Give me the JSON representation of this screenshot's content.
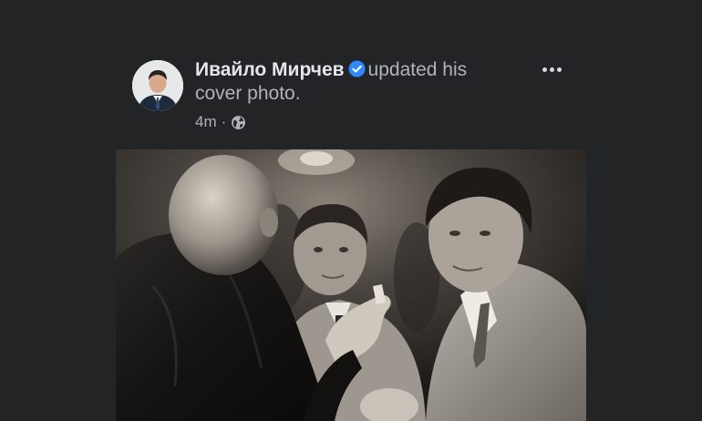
{
  "post": {
    "author": "Ивайло Мирчев",
    "action_line1": "updated his",
    "action_line2": "cover photo.",
    "time": "4m",
    "separator": "·",
    "visibility_icon": "globe-icon",
    "more_icon": "more-options-icon",
    "verified_icon": "verified-badge-icon"
  },
  "colors": {
    "background": "#232425",
    "author_text": "#e4e6eb",
    "secondary_text": "#b0b3b8",
    "verified": "#2d88ff"
  }
}
